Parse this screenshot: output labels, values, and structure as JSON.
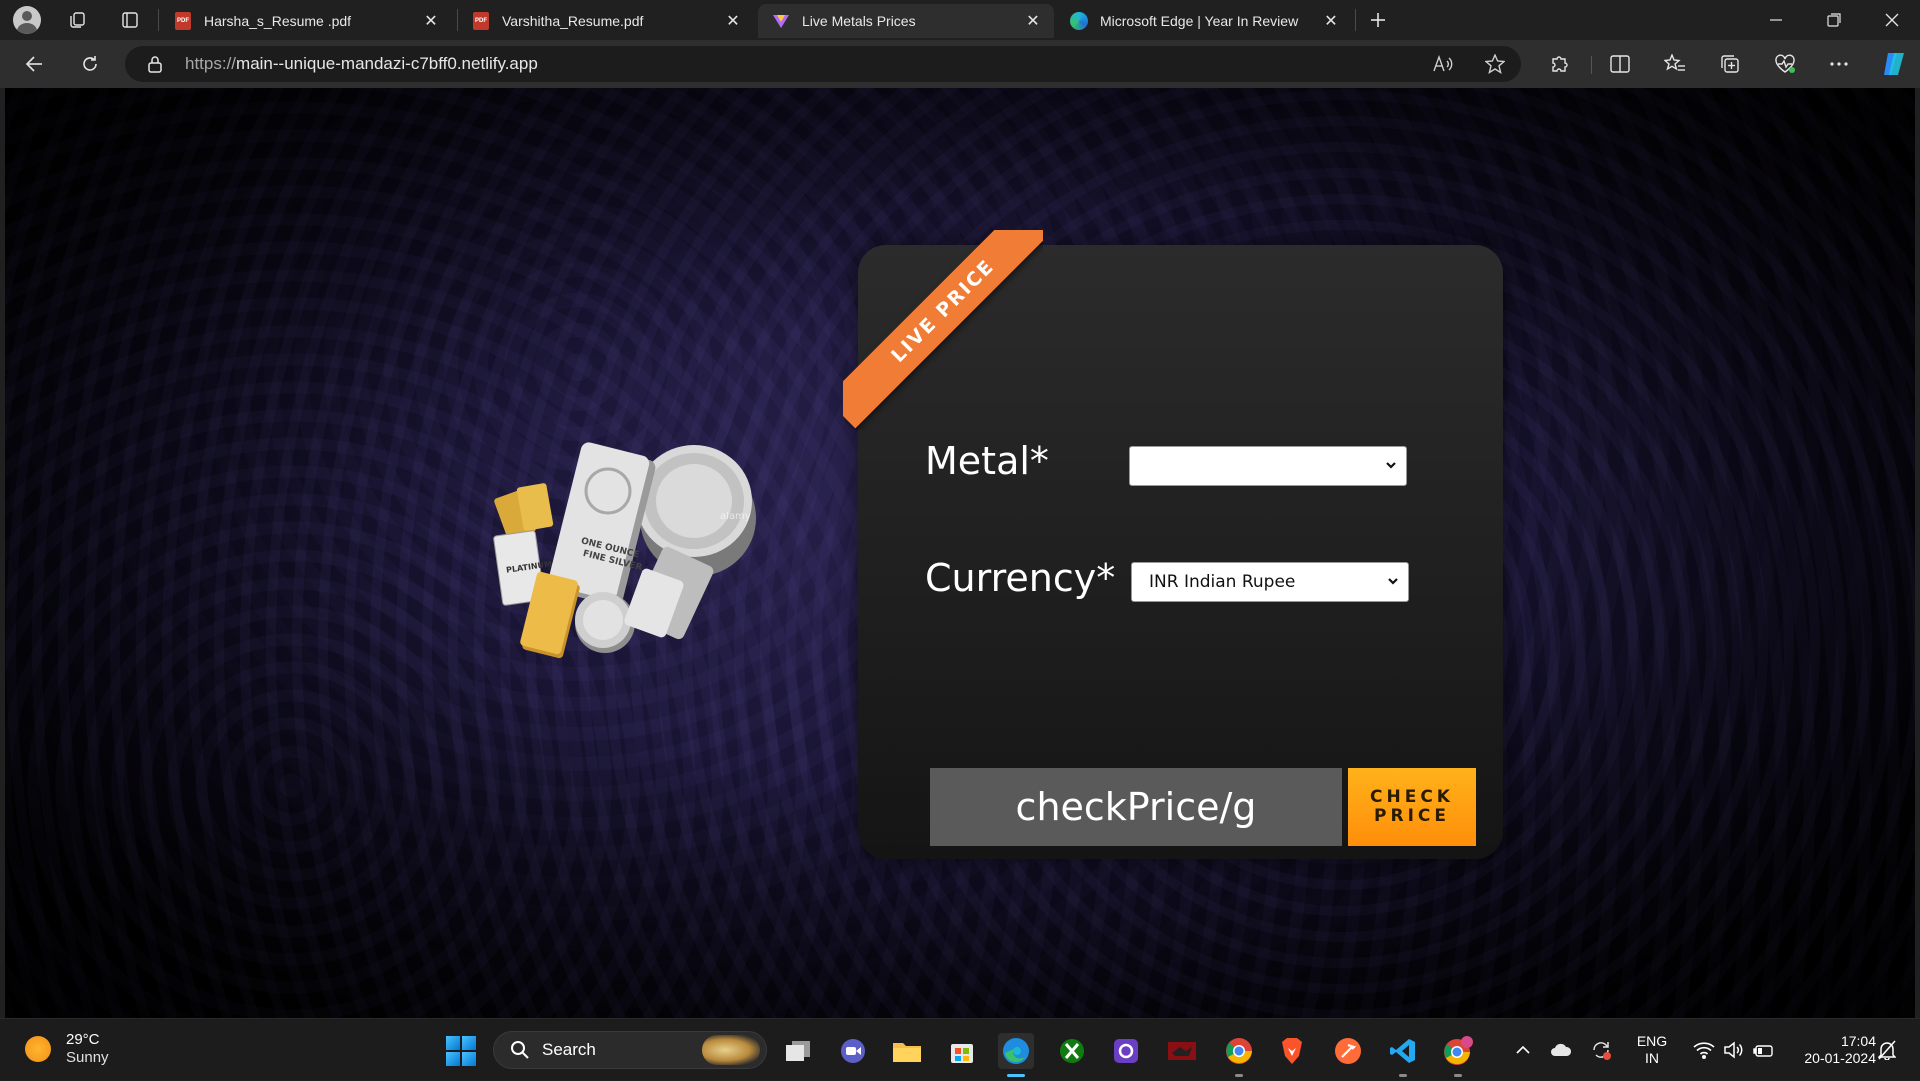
{
  "browser": {
    "tabs": [
      {
        "title": "Harsha_s_Resume .pdf",
        "favicon": "pdf-icon",
        "active": false
      },
      {
        "title": "Varshitha_Resume.pdf",
        "favicon": "pdf-icon",
        "active": false
      },
      {
        "title": "Live Metals Prices",
        "favicon": "site-icon",
        "active": true
      },
      {
        "title": "Microsoft Edge | Year In Review",
        "favicon": "edge-icon",
        "active": false
      }
    ],
    "address": {
      "protocol": "https://",
      "host": "main--unique-mandazi-c7bff0.netlify.app"
    }
  },
  "page": {
    "ribbon": "LIVE PRICE",
    "metal_label": "Metal*",
    "metal_value": "",
    "currency_label": "Currency*",
    "currency_value": "INR Indian Rupee",
    "price_display": "checkPrice/g",
    "check_button": "CHECK PRICE",
    "bar_texts": [
      "ONE OUNCE",
      "FINE SILVER",
      "PLATINUM",
      "alamy"
    ]
  },
  "taskbar": {
    "weather": {
      "temp": "29°C",
      "condition": "Sunny"
    },
    "search_label": "Search",
    "language": {
      "line1": "ENG",
      "line2": "IN"
    },
    "clock": {
      "time": "17:04",
      "date": "20-01-2024"
    }
  },
  "colors": {
    "ribbon": "#f07c35",
    "button": "#ff9f12",
    "price_box": "#5a5a5a"
  }
}
